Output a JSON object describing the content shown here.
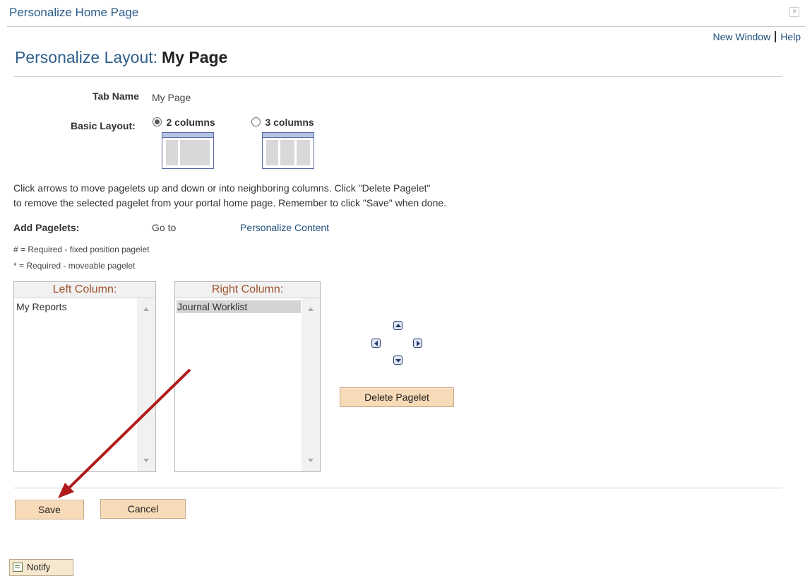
{
  "dialog": {
    "title": "Personalize Home Page",
    "close_symbol": "×"
  },
  "toplinks": {
    "new_window": "New Window",
    "help": "Help"
  },
  "heading": {
    "prefix": "Personalize Layout:",
    "name": "My Page"
  },
  "tab_name": {
    "label": "Tab Name",
    "value": "My Page"
  },
  "basic_layout": {
    "label": "Basic Layout:",
    "options": [
      {
        "label": "2 columns",
        "selected": true
      },
      {
        "label": "3 columns",
        "selected": false
      }
    ]
  },
  "instructions": {
    "line1": "Click arrows to move pagelets up and down or into neighboring columns. Click \"Delete Pagelet\"",
    "line2": "to remove the selected pagelet from your portal home page. Remember to click \"Save\" when done."
  },
  "add_pagelets": {
    "label": "Add Pagelets:",
    "go_to": "Go to",
    "link": "Personalize Content"
  },
  "legend": {
    "fixed": "# = Required - fixed position pagelet",
    "moveable": "* = Required - moveable pagelet"
  },
  "left_column": {
    "header": "Left Column:",
    "items": [
      "My Reports"
    ]
  },
  "right_column": {
    "header": "Right Column:",
    "items": [
      "Journal Worklist"
    ],
    "selected_index": 0
  },
  "buttons": {
    "delete_pagelet": "Delete Pagelet",
    "save": "Save",
    "cancel": "Cancel",
    "notify": "Notify"
  },
  "colors": {
    "link": "#1f4f7a",
    "heading": "#2f5f8c",
    "column_header": "#a0522d",
    "button": "#f7dab7",
    "annotation_arrow": "#b01c1c"
  }
}
